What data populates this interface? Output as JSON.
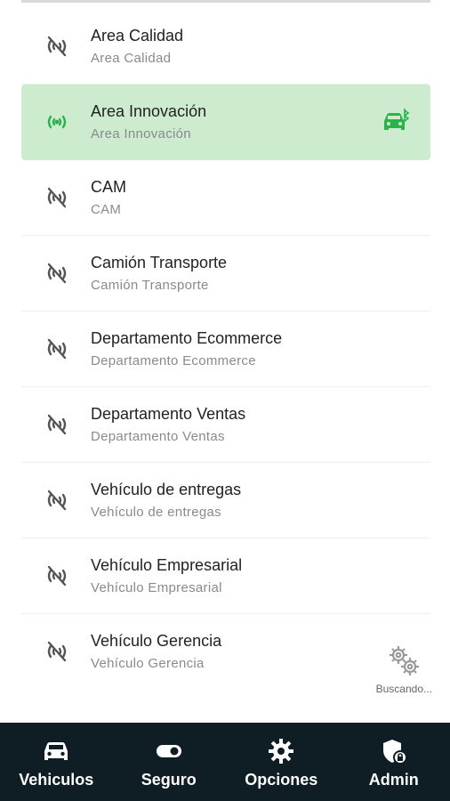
{
  "vehicles": [
    {
      "title": "Area Calidad",
      "subtitle": "Area Calidad",
      "status": "disconnected"
    },
    {
      "title": "Area Innovación",
      "subtitle": "Area Innovación",
      "status": "connected"
    },
    {
      "title": "CAM",
      "subtitle": "CAM",
      "status": "disconnected"
    },
    {
      "title": "Camión Transporte",
      "subtitle": "Camión Transporte",
      "status": "disconnected"
    },
    {
      "title": "Departamento Ecommerce",
      "subtitle": "Departamento Ecommerce",
      "status": "disconnected"
    },
    {
      "title": "Departamento Ventas",
      "subtitle": "Departamento Ventas",
      "status": "disconnected"
    },
    {
      "title": "Vehículo de entregas",
      "subtitle": "Vehículo de entregas",
      "status": "disconnected"
    },
    {
      "title": "Vehículo Empresarial",
      "subtitle": "Vehículo Empresarial",
      "status": "disconnected"
    },
    {
      "title": "Vehículo Gerencia",
      "subtitle": "Vehículo Gerencia",
      "status": "disconnected"
    }
  ],
  "searching": {
    "label": "Buscando...",
    "icon": "gears-icon"
  },
  "nav": [
    {
      "label": "Vehiculos",
      "icon": "car-icon"
    },
    {
      "label": "Seguro",
      "icon": "toggle-icon"
    },
    {
      "label": "Opciones",
      "icon": "gear-icon"
    },
    {
      "label": "Admin",
      "icon": "shield-lock-icon"
    }
  ],
  "colors": {
    "active_bg": "#cdeccf",
    "accent_green": "#2bb24c",
    "nav_bg": "#0f1d24",
    "icon_gray": "#555555"
  }
}
